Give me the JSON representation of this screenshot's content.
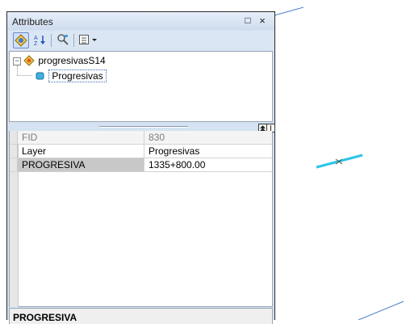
{
  "window": {
    "title": "Attributes",
    "restore_glyph": "□",
    "close_glyph": "×"
  },
  "toolbar": {
    "buttons": [
      {
        "name": "list-by-layer-icon",
        "active": true
      },
      {
        "name": "sort-ascending-icon",
        "active": false
      },
      {
        "name": "select-features-icon",
        "active": false
      },
      {
        "name": "options-icon",
        "active": false
      }
    ]
  },
  "tree": {
    "layer": "progresivasS14",
    "feature": "Progresivas",
    "expand_glyph": "−"
  },
  "grid": {
    "rows": [
      {
        "field": "FID",
        "value": "830"
      },
      {
        "field": "Layer",
        "value": "Progresivas"
      },
      {
        "field": "PROGRESIVA",
        "value": "1335+800.00"
      }
    ]
  },
  "description": {
    "field_label": "PROGRESIVA"
  },
  "map": {
    "feature_color": "#29c6e8"
  }
}
